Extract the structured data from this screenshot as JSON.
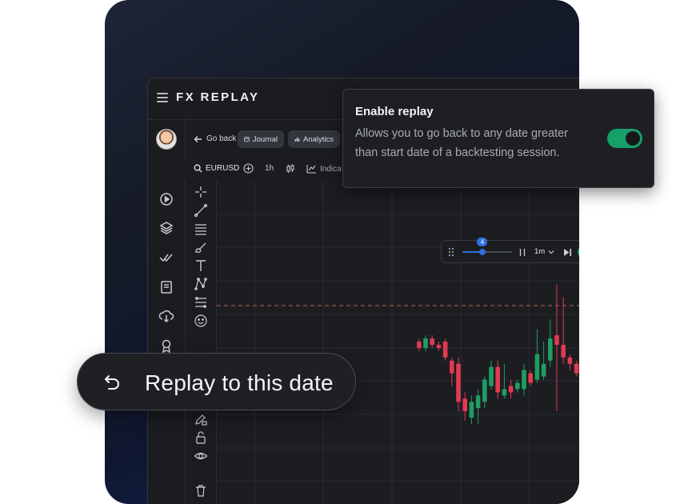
{
  "header": {
    "logo": "FX REPLAY",
    "menu_icon": "hamburger-icon"
  },
  "sidebar": {
    "items": [
      {
        "icon": "home-icon"
      },
      {
        "icon": "play-icon"
      },
      {
        "icon": "layers-icon"
      },
      {
        "icon": "checks-icon"
      },
      {
        "icon": "book-icon"
      },
      {
        "icon": "cloud-download-icon"
      },
      {
        "icon": "award-icon"
      }
    ]
  },
  "toolbar": {
    "go_back": "Go back",
    "journal": "Journal",
    "analytics": "Analytics",
    "symbol": "EURUSD",
    "timeframe": "1h",
    "indicators": "Indica"
  },
  "replay_controls": {
    "speed_badge": "4",
    "speed_level": 0.4,
    "interval": "1m",
    "colors": {
      "accent": "#2f6fe0"
    }
  },
  "enable_replay": {
    "title": "Enable replay",
    "description": "Allows you to go back to any date greater than start date of a backtesting session.",
    "enabled": true,
    "colors": {
      "toggle_on": "#16a06a"
    }
  },
  "replay_button": {
    "label": "Replay to this date",
    "icon": "undo-arrow-icon"
  },
  "chart": {
    "colors": {
      "up": "#1f9d62",
      "down": "#e23a52",
      "grid": "#2a2c31",
      "dashed_line": "#c25a5a"
    },
    "candles": [
      {
        "o": 0.52,
        "c": 0.5,
        "h": 0.53,
        "l": 0.49
      },
      {
        "o": 0.5,
        "c": 0.53,
        "h": 0.54,
        "l": 0.49
      },
      {
        "o": 0.53,
        "c": 0.51,
        "h": 0.54,
        "l": 0.5
      },
      {
        "o": 0.51,
        "c": 0.5,
        "h": 0.52,
        "l": 0.49
      },
      {
        "o": 0.52,
        "c": 0.47,
        "h": 0.53,
        "l": 0.46
      },
      {
        "o": 0.46,
        "c": 0.42,
        "h": 0.47,
        "l": 0.38
      },
      {
        "o": 0.45,
        "c": 0.33,
        "h": 0.47,
        "l": 0.3
      },
      {
        "o": 0.34,
        "c": 0.3,
        "h": 0.36,
        "l": 0.27
      },
      {
        "o": 0.28,
        "c": 0.33,
        "h": 0.35,
        "l": 0.26
      },
      {
        "o": 0.31,
        "c": 0.35,
        "h": 0.37,
        "l": 0.26
      },
      {
        "o": 0.33,
        "c": 0.4,
        "h": 0.41,
        "l": 0.31
      },
      {
        "o": 0.38,
        "c": 0.44,
        "h": 0.46,
        "l": 0.37
      },
      {
        "o": 0.44,
        "c": 0.36,
        "h": 0.46,
        "l": 0.34
      },
      {
        "o": 0.35,
        "c": 0.37,
        "h": 0.45,
        "l": 0.34
      },
      {
        "o": 0.38,
        "c": 0.36,
        "h": 0.4,
        "l": 0.34
      },
      {
        "o": 0.37,
        "c": 0.39,
        "h": 0.4,
        "l": 0.36
      },
      {
        "o": 0.37,
        "c": 0.43,
        "h": 0.45,
        "l": 0.35
      },
      {
        "o": 0.42,
        "c": 0.39,
        "h": 0.43,
        "l": 0.38
      },
      {
        "o": 0.4,
        "c": 0.48,
        "h": 0.56,
        "l": 0.39
      },
      {
        "o": 0.41,
        "c": 0.45,
        "h": 0.52,
        "l": 0.4
      },
      {
        "o": 0.46,
        "c": 0.53,
        "h": 0.59,
        "l": 0.44
      },
      {
        "o": 0.54,
        "c": 0.51,
        "h": 0.7,
        "l": 0.3
      },
      {
        "o": 0.51,
        "c": 0.47,
        "h": 0.66,
        "l": 0.45
      },
      {
        "o": 0.47,
        "c": 0.45,
        "h": 0.48,
        "l": 0.43
      },
      {
        "o": 0.45,
        "c": 0.42,
        "h": 0.46,
        "l": 0.41
      },
      {
        "o": 0.43,
        "c": 0.46,
        "h": 0.47,
        "l": 0.42
      },
      {
        "o": 0.46,
        "c": 0.48,
        "h": 0.49,
        "l": 0.45
      }
    ]
  }
}
